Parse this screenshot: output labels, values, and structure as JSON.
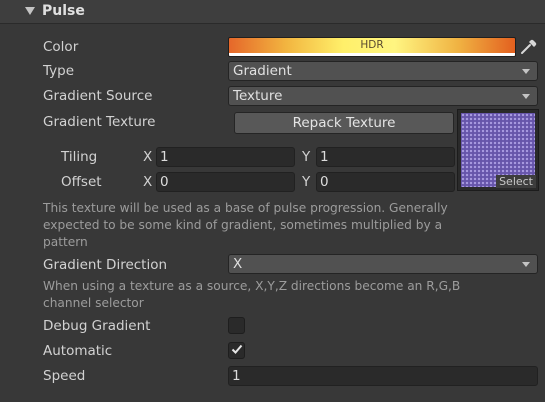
{
  "header": {
    "title": "Pulse"
  },
  "color": {
    "label": "Color",
    "badge": "HDR"
  },
  "type": {
    "label": "Type",
    "value": "Gradient"
  },
  "gradient_source": {
    "label": "Gradient Source",
    "value": "Texture"
  },
  "gradient_texture": {
    "label": "Gradient Texture",
    "button": "Repack Texture",
    "select": "Select"
  },
  "tiling": {
    "label": "Tiling",
    "x_label": "X",
    "x": "1",
    "y_label": "Y",
    "y": "1"
  },
  "offset": {
    "label": "Offset",
    "x_label": "X",
    "x": "0",
    "y_label": "Y",
    "y": "0"
  },
  "help_texture": [
    "This texture will be used as a base of pulse progression. Generally",
    "expected to be some kind of gradient, sometimes multiplied by a",
    "pattern"
  ],
  "gradient_direction": {
    "label": "Gradient Direction",
    "value": "X"
  },
  "help_direction": [
    "When using a texture as a source, X,Y,Z directions become an R,G,B",
    "channel selector"
  ],
  "debug_gradient": {
    "label": "Debug Gradient",
    "checked": false
  },
  "automatic": {
    "label": "Automatic",
    "checked": true
  },
  "speed": {
    "label": "Speed",
    "value": "1"
  }
}
